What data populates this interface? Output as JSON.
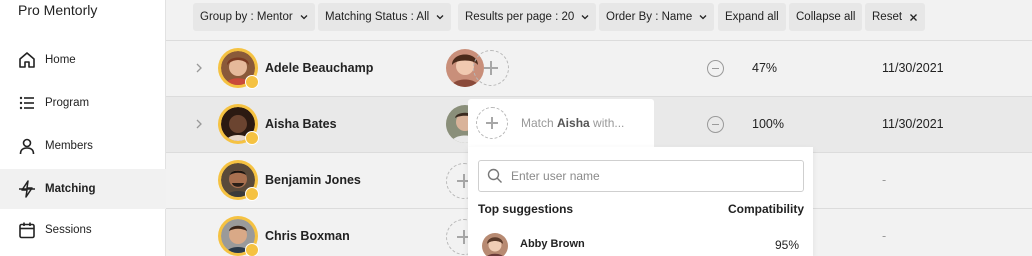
{
  "app": {
    "brand": "Pro Mentorly"
  },
  "sidebar": {
    "items": [
      {
        "label": "Home",
        "icon": "home-icon"
      },
      {
        "label": "Program",
        "icon": "list-icon"
      },
      {
        "label": "Members",
        "icon": "user-icon"
      },
      {
        "label": "Matching",
        "icon": "matching-icon",
        "active": true
      },
      {
        "label": "Sessions",
        "icon": "calendar-icon"
      }
    ]
  },
  "toolbar": {
    "group_by": "Group by : Mentor",
    "matching_status": "Matching Status : All",
    "results_per_page": "Results per page : 20",
    "order_by": "Order By : Name",
    "expand_all": "Expand all",
    "collapse_all": "Collapse all",
    "reset": "Reset"
  },
  "rows": [
    {
      "name": "Adele Beauchamp",
      "compatibility": "47%",
      "date": "11/30/2021",
      "has_mentee": true
    },
    {
      "name": "Aisha Bates",
      "compatibility": "100%",
      "date": "11/30/2021",
      "has_mentee": true
    },
    {
      "name": "Benjamin Jones",
      "compatibility": "",
      "date": "-",
      "has_mentee": false
    },
    {
      "name": "Chris Boxman",
      "compatibility": "",
      "date": "-",
      "has_mentee": false
    }
  ],
  "popup": {
    "match_prefix": "Match ",
    "match_name": "Aisha",
    "match_suffix": " with...",
    "search_placeholder": "Enter user name",
    "top_suggestions_label": "Top suggestions",
    "compatibility_label": "Compatibility",
    "suggestions": [
      {
        "name": "Abby Brown",
        "compatibility": "95%"
      }
    ]
  },
  "colors": {
    "accent_avatar_ring": "#f5c242",
    "background": "#f2f2f2",
    "row_alt": "#e9e9e9"
  }
}
